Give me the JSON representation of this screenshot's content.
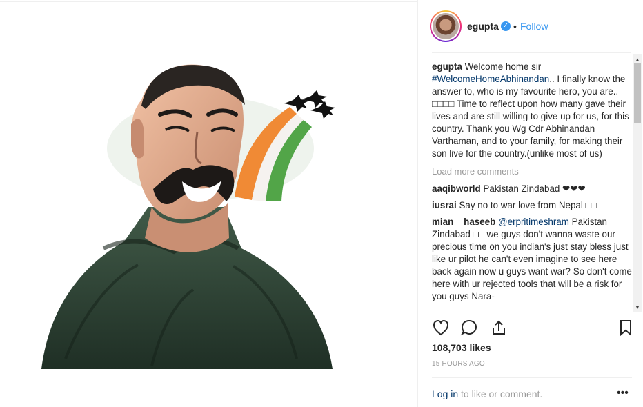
{
  "post": {
    "image_alt": "",
    "username": "egupta",
    "verified_mark": "✓",
    "separator": "•",
    "follow_label": "Follow",
    "caption": {
      "username": "egupta",
      "text_before_tag": "Welcome home sir",
      "hashtag": "#WelcomeHomeAbhinandan",
      "text_after_tag": ".. I finally know the answer to, who is my favourite hero, you are.. □□□□ Time to reflect upon how many gave their lives and are still willing to give up for us, for this country. Thank you Wg Cdr Abhinandan Varthaman, and to your family, for making their son live for the country.(unlike most of us)"
    },
    "load_more": "Load more comments",
    "comments": [
      {
        "user": "aaqibworld",
        "text": "Pakistan Zindabad ❤❤❤"
      },
      {
        "user": "iusrai",
        "text": "Say no to war love from Nepal □□"
      },
      {
        "user": "mian__haseeb",
        "mention": "@erpritimeshram",
        "text": " Pakistan Zindabad □□ we guys don't wanna waste our precious time on you indian's just stay bless just like ur pilot he can't even imagine to see here back again now u guys want war? So don't come here with ur rejected tools that will be a risk for you guys Nara-"
      }
    ],
    "likes": "108,703 likes",
    "timestamp": "15 HOURS AGO",
    "login_link": "Log in",
    "login_rest": " to like or comment.",
    "more_options": "•••",
    "icons": [
      "heart-icon",
      "comment-icon",
      "share-icon",
      "bookmark-icon",
      "verified-icon"
    ]
  }
}
